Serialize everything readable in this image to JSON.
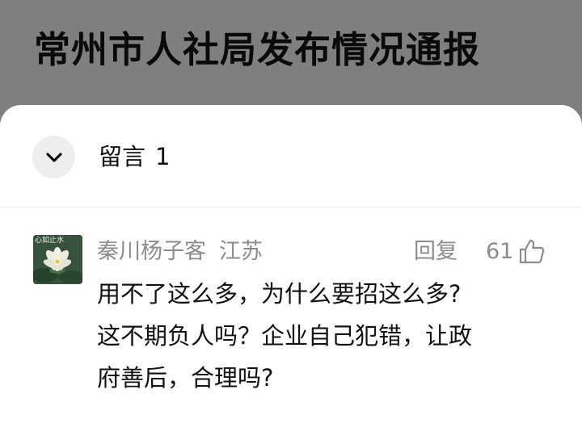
{
  "article": {
    "title": "常州市人社局发布情况通报"
  },
  "comments_sheet": {
    "title": "留言",
    "count": "1",
    "collapse_icon": "chevron-down-icon"
  },
  "comments": [
    {
      "avatar_caption": "心如止水",
      "avatar_image": "lotus-flower",
      "author": "秦川杨子客",
      "location": "江苏",
      "reply_label": "回复",
      "likes": "61",
      "like_icon": "thumbs-up-icon",
      "text_lines": [
        "用不了这么多，为什么要招这么多?",
        "这不期负人吗？企业自己犯错，让政",
        "府善后，合理吗?"
      ]
    }
  ],
  "colors": {
    "overlay": "#7f7f7f",
    "sheet": "#ffffff",
    "meta_text": "#8c8c8c",
    "body_text": "#111111"
  }
}
